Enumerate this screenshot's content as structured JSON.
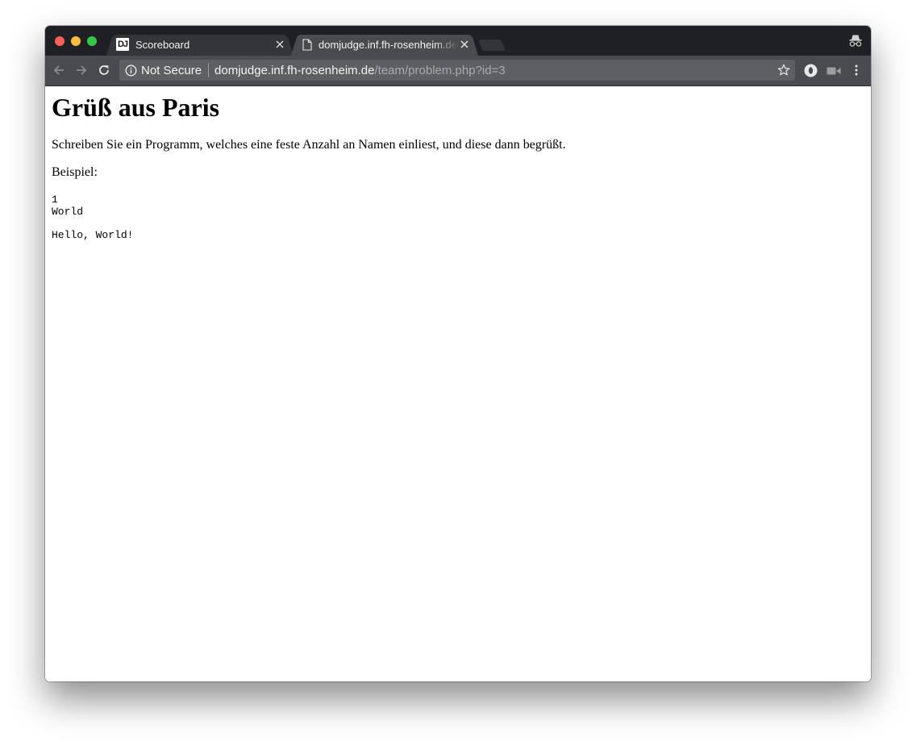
{
  "browser": {
    "tabs": [
      {
        "favicon": "DJ",
        "title": "Scoreboard",
        "active": false
      },
      {
        "favicon": "document-icon",
        "title": "domjudge.inf.fh-rosenheim.de/",
        "active": true
      }
    ],
    "address_bar": {
      "security_label": "Not Secure",
      "url_host": "domjudge.inf.fh-rosenheim.de",
      "url_path": "/team/problem.php?id=3"
    }
  },
  "page": {
    "title": "Grüß aus Paris",
    "description": "Schreiben Sie ein Programm, welches eine feste Anzahl an Namen einliest, und diese dann begrüßt.",
    "example_label": "Beispiel:",
    "example_input": "1\nWorld",
    "example_output": "Hello, World!"
  }
}
